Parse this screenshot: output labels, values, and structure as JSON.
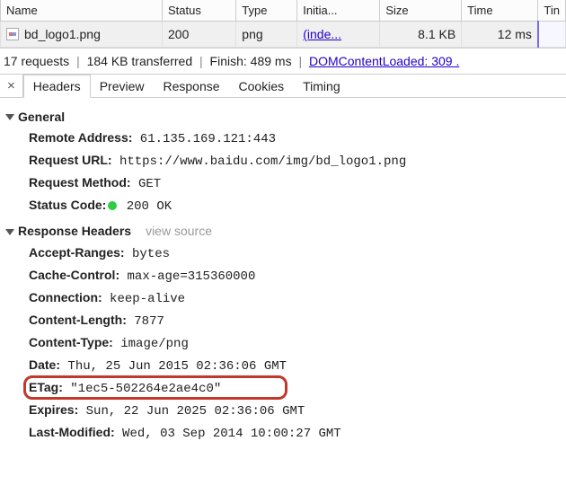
{
  "table": {
    "columns": [
      "Name",
      "Status",
      "Type",
      "Initia...",
      "Size",
      "Time",
      "Tin"
    ],
    "row": {
      "name": "bd_logo1.png",
      "status": "200",
      "type": "png",
      "initiator": "(inde...",
      "size": "8.1 KB",
      "time": "12 ms"
    }
  },
  "status_line": {
    "requests": "17 requests",
    "transferred": "184 KB transferred",
    "finish": "Finish: 489 ms",
    "dom": "DOMContentLoaded: 309 ."
  },
  "tabs": [
    "Headers",
    "Preview",
    "Response",
    "Cookies",
    "Timing"
  ],
  "close_label": "×",
  "sections": {
    "general": {
      "title": "General",
      "rows": [
        {
          "k": "Remote Address:",
          "v": " 61.135.169.121:443"
        },
        {
          "k": "Request URL:",
          "v": " https://www.baidu.com/img/bd_logo1.png"
        },
        {
          "k": "Request Method:",
          "v": " GET"
        },
        {
          "k": "Status Code:",
          "v": " 200 OK",
          "status_dot": true
        }
      ]
    },
    "response": {
      "title": "Response Headers",
      "view_source": "view source",
      "rows": [
        {
          "k": "Accept-Ranges:",
          "v": " bytes"
        },
        {
          "k": "Cache-Control:",
          "v": " max-age=315360000"
        },
        {
          "k": "Connection:",
          "v": " keep-alive"
        },
        {
          "k": "Content-Length:",
          "v": " 7877"
        },
        {
          "k": "Content-Type:",
          "v": " image/png"
        },
        {
          "k": "Date:",
          "v": " Thu, 25 Jun 2015 02:36:06 GMT"
        },
        {
          "k": "ETag:",
          "v": " \"1ec5-502264e2ae4c0\"",
          "highlight": true
        },
        {
          "k": "Expires:",
          "v": " Sun, 22 Jun 2025 02:36:06 GMT"
        },
        {
          "k": "Last-Modified:",
          "v": " Wed, 03 Sep 2014 10:00:27 GMT"
        }
      ]
    }
  }
}
